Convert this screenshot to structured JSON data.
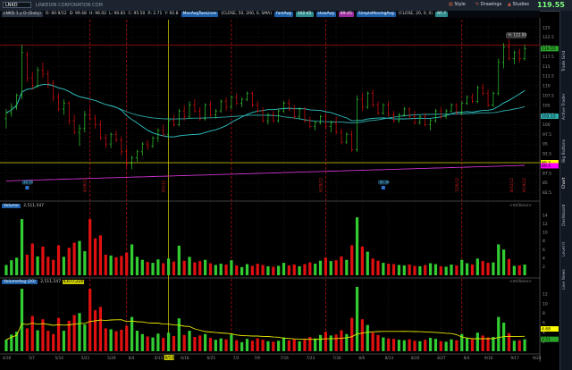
{
  "toolbar": {
    "symbol": "LNKD",
    "company_name": "LINKEDIN CORPORATION COM",
    "last_price": "119.55",
    "buttons": [
      "Style",
      "Drawings",
      "Studies"
    ]
  },
  "infobar": {
    "items": [
      {
        "text": "LNKD 1 y D (Daily)",
        "color": "#d6d6d6",
        "bg": "#2a3340"
      },
      {
        "text": "O: 60.9/12",
        "color": "#d6d6d6",
        "bg": ""
      },
      {
        "text": "D: 99.48",
        "color": "#d6d6d6",
        "bg": ""
      },
      {
        "text": "H: 96.02",
        "color": "#d6d6d6",
        "bg": ""
      },
      {
        "text": "L: 90.81",
        "color": "#d6d6d6",
        "bg": ""
      },
      {
        "text": "C: 95.50",
        "color": "#d6d6d6",
        "bg": ""
      },
      {
        "text": "R: 2.71",
        "color": "#d6d6d6",
        "bg": ""
      },
      {
        "text": "Y: 92.8",
        "color": "#d6d6d6",
        "bg": ""
      },
      {
        "text": "MovAvgTwoLines",
        "color": "#ffffff",
        "bg": "#1d5fa8"
      },
      {
        "text": "(CLOSE, 50, 200, 0, SMA)",
        "color": "#d6d6d6",
        "bg": ""
      },
      {
        "text": "fastAvg",
        "color": "#ffffff",
        "bg": "#1d5fa8"
      },
      {
        "text": "102.45",
        "color": "#ffffff",
        "bg": "#2f8c8c"
      },
      {
        "text": "slowAvg",
        "color": "#ffffff",
        "bg": "#1d5fa8"
      },
      {
        "text": "89.45",
        "color": "#ffffff",
        "bg": "#9c2d9c"
      },
      {
        "text": "SimpleMovingAvg",
        "color": "#ffffff",
        "bg": "#1d5fa8"
      },
      {
        "text": "(CLOSE, 20, 0, 0)",
        "color": "#d6d6d6",
        "bg": ""
      },
      {
        "text": "97.7",
        "color": "#ffffff",
        "bg": "#2f8c8c"
      }
    ],
    "copyright": "2012 ® TD Ameritrade IP Company, Inc."
  },
  "price_panel": {
    "y_ticks": [
      125,
      122.5,
      120,
      117.5,
      115,
      112.5,
      110,
      107.5,
      105,
      102.5,
      100,
      97.5,
      95,
      92.5,
      90,
      87.5,
      85,
      82.5
    ],
    "price_boxes": [
      {
        "text": "119.55",
        "bg": "#2aa52a",
        "y": 119.55
      },
      {
        "text": "102.15",
        "bg": "#2faaaa",
        "y": 102.15
      },
      {
        "text": "90.2",
        "bg": "#ffff00",
        "y": 90.2
      },
      {
        "text": "89.4",
        "bg": "#ff00ff",
        "y": 89.4
      }
    ],
    "high_label": "H: 122.00",
    "event_labels": [
      "4/26/12",
      "6/1/12",
      "6/29/12",
      "7/26/12",
      "8/31/12",
      "9/19/12"
    ],
    "dividend_markers": [
      "$0.15",
      "$0.16"
    ]
  },
  "volume_panel": {
    "title": "Volume",
    "value": "2,511,547",
    "units": "<millions>",
    "y_ticks": [
      14,
      12,
      10,
      8,
      6,
      4,
      2
    ]
  },
  "volavg_panel": {
    "title": "VolumeAvg (20)",
    "value1": "2,511,547",
    "value2": "4,677,220",
    "units": "<millions>",
    "y_ticks": [
      12,
      10,
      8,
      6,
      4,
      2
    ],
    "price_boxes": [
      {
        "text": "4.68",
        "bg": "#ffff00",
        "y": 4.68
      },
      {
        "text": "2.51",
        "bg": "#2aa52a",
        "y": 2.51
      }
    ]
  },
  "x_axis": {
    "labels": [
      "4/30",
      "5/7",
      "5/14",
      "5/21",
      "5/29",
      "6/4",
      "6/11",
      "6/18",
      "6/25",
      "7/2",
      "7/9",
      "7/16",
      "7/23",
      "7/30",
      "8/6",
      "8/13",
      "8/20",
      "8/27",
      "9/4",
      "9/10",
      "9/17",
      "9/24"
    ],
    "highlight": "6/13"
  },
  "right_tabs": [
    "Trade Grid",
    "Active Trader",
    "Big Buttons",
    "Chart",
    "Dashboard",
    "Level II",
    "Live News"
  ],
  "colors": {
    "up": "#32cd32",
    "down": "#e01010",
    "sma20": "#2ec5c5",
    "sma50": "#2faaaa",
    "sma200": "#cc33cc",
    "hline": "#b01010",
    "yline": "#d4d400",
    "vline": "#b01010"
  },
  "chart_data": {
    "type": "candlestick",
    "bars": [
      {
        "x": "4/30",
        "o": 101.5,
        "h": 104.0,
        "l": 99.0,
        "c": 103.0,
        "v": 2.4
      },
      {
        "x": "5/1",
        "o": 103.0,
        "h": 105.5,
        "l": 102.0,
        "c": 104.5,
        "v": 3.5
      },
      {
        "x": "5/2",
        "o": 104.5,
        "h": 108.0,
        "l": 103.8,
        "c": 107.5,
        "v": 4.1
      },
      {
        "x": "5/3",
        "o": 107.5,
        "h": 120.5,
        "l": 106.5,
        "c": 118.5,
        "v": 13.1
      },
      {
        "x": "5/4",
        "o": 118.0,
        "h": 118.8,
        "l": 111.0,
        "c": 112.0,
        "v": 4.8
      },
      {
        "x": "5/7",
        "o": 112.0,
        "h": 113.5,
        "l": 109.0,
        "c": 110.0,
        "v": 7.4
      },
      {
        "x": "5/8",
        "o": 110.0,
        "h": 114.8,
        "l": 109.5,
        "c": 114.0,
        "v": 4.4
      },
      {
        "x": "5/9",
        "o": 114.0,
        "h": 116.0,
        "l": 112.0,
        "c": 113.0,
        "v": 6.7
      },
      {
        "x": "5/10",
        "o": 113.0,
        "h": 114.0,
        "l": 109.5,
        "c": 110.5,
        "v": 4.3
      },
      {
        "x": "5/11",
        "o": 110.5,
        "h": 111.5,
        "l": 106.0,
        "c": 107.0,
        "v": 3.6
      },
      {
        "x": "5/14",
        "o": 107.0,
        "h": 108.0,
        "l": 103.5,
        "c": 104.0,
        "v": 7.0
      },
      {
        "x": "5/15",
        "o": 104.0,
        "h": 106.5,
        "l": 102.5,
        "c": 105.5,
        "v": 4.3
      },
      {
        "x": "5/16",
        "o": 105.5,
        "h": 106.0,
        "l": 100.0,
        "c": 101.0,
        "v": 6.4
      },
      {
        "x": "5/17",
        "o": 101.0,
        "h": 102.5,
        "l": 97.5,
        "c": 98.0,
        "v": 7.6
      },
      {
        "x": "5/18",
        "o": 98.0,
        "h": 100.0,
        "l": 94.5,
        "c": 99.0,
        "v": 8.0
      },
      {
        "x": "5/21",
        "o": 99.0,
        "h": 103.5,
        "l": 98.0,
        "c": 102.5,
        "v": 5.6
      },
      {
        "x": "5/22",
        "o": 102.5,
        "h": 104.5,
        "l": 101.0,
        "c": 101.5,
        "v": 13.1
      },
      {
        "x": "5/23",
        "o": 101.5,
        "h": 102.5,
        "l": 99.0,
        "c": 100.0,
        "v": 8.6
      },
      {
        "x": "5/24",
        "o": 100.0,
        "h": 101.0,
        "l": 96.0,
        "c": 96.5,
        "v": 9.3
      },
      {
        "x": "5/25",
        "o": 96.5,
        "h": 97.5,
        "l": 94.0,
        "c": 95.0,
        "v": 4.8
      },
      {
        "x": "5/29",
        "o": 95.0,
        "h": 98.0,
        "l": 94.0,
        "c": 97.5,
        "v": 4.6
      },
      {
        "x": "5/30",
        "o": 97.5,
        "h": 98.5,
        "l": 95.5,
        "c": 96.0,
        "v": 4.2
      },
      {
        "x": "5/31",
        "o": 96.0,
        "h": 97.0,
        "l": 92.0,
        "c": 93.0,
        "v": 4.5
      },
      {
        "x": "6/1",
        "o": 93.0,
        "h": 94.0,
        "l": 89.0,
        "c": 90.0,
        "v": 5.3
      },
      {
        "x": "6/4",
        "o": 90.0,
        "h": 92.0,
        "l": 88.5,
        "c": 91.5,
        "v": 7.2
      },
      {
        "x": "6/5",
        "o": 91.5,
        "h": 93.5,
        "l": 90.5,
        "c": 93.0,
        "v": 4.3
      },
      {
        "x": "6/6",
        "o": 93.0,
        "h": 95.5,
        "l": 92.0,
        "c": 95.0,
        "v": 3.6
      },
      {
        "x": "6/7",
        "o": 95.0,
        "h": 96.0,
        "l": 93.5,
        "c": 94.5,
        "v": 3.1
      },
      {
        "x": "6/8",
        "o": 94.5,
        "h": 97.0,
        "l": 94.0,
        "c": 96.5,
        "v": 2.9
      },
      {
        "x": "6/11",
        "o": 96.5,
        "h": 99.0,
        "l": 95.5,
        "c": 98.5,
        "v": 3.7
      },
      {
        "x": "6/12",
        "o": 98.5,
        "h": 100.0,
        "l": 97.0,
        "c": 97.5,
        "v": 2.8
      },
      {
        "x": "6/13",
        "o": 97.5,
        "h": 101.5,
        "l": 97.0,
        "c": 101.0,
        "v": 3.9
      },
      {
        "x": "6/14",
        "o": 101.0,
        "h": 102.5,
        "l": 99.5,
        "c": 100.0,
        "v": 3.2
      },
      {
        "x": "6/15",
        "o": 100.0,
        "h": 104.0,
        "l": 99.5,
        "c": 103.5,
        "v": 6.9
      },
      {
        "x": "6/18",
        "o": 103.5,
        "h": 105.0,
        "l": 101.0,
        "c": 102.0,
        "v": 3.4
      },
      {
        "x": "6/19",
        "o": 102.0,
        "h": 106.0,
        "l": 101.5,
        "c": 105.0,
        "v": 4.3
      },
      {
        "x": "6/20",
        "o": 105.0,
        "h": 106.5,
        "l": 103.0,
        "c": 103.5,
        "v": 3.0
      },
      {
        "x": "6/21",
        "o": 103.5,
        "h": 104.5,
        "l": 101.0,
        "c": 101.5,
        "v": 3.3
      },
      {
        "x": "6/22",
        "o": 101.5,
        "h": 105.5,
        "l": 101.0,
        "c": 105.0,
        "v": 3.6
      },
      {
        "x": "6/25",
        "o": 105.0,
        "h": 106.0,
        "l": 102.0,
        "c": 102.5,
        "v": 2.8
      },
      {
        "x": "6/26",
        "o": 102.5,
        "h": 104.0,
        "l": 101.5,
        "c": 103.5,
        "v": 2.4
      },
      {
        "x": "6/27",
        "o": 103.5,
        "h": 106.5,
        "l": 103.0,
        "c": 106.0,
        "v": 2.7
      },
      {
        "x": "6/28",
        "o": 106.0,
        "h": 107.0,
        "l": 103.5,
        "c": 104.5,
        "v": 2.5
      },
      {
        "x": "6/29",
        "o": 104.5,
        "h": 107.5,
        "l": 104.0,
        "c": 107.0,
        "v": 3.5
      },
      {
        "x": "7/2",
        "o": 107.0,
        "h": 108.0,
        "l": 105.0,
        "c": 105.5,
        "v": 2.3
      },
      {
        "x": "7/3",
        "o": 105.5,
        "h": 107.0,
        "l": 104.5,
        "c": 106.5,
        "v": 1.9
      },
      {
        "x": "7/5",
        "o": 106.5,
        "h": 108.5,
        "l": 106.0,
        "c": 108.0,
        "v": 2.6
      },
      {
        "x": "7/6",
        "o": 108.0,
        "h": 108.5,
        "l": 104.5,
        "c": 105.0,
        "v": 2.2
      },
      {
        "x": "7/9",
        "o": 105.0,
        "h": 106.0,
        "l": 103.0,
        "c": 103.5,
        "v": 2.7
      },
      {
        "x": "7/10",
        "o": 103.5,
        "h": 104.5,
        "l": 100.5,
        "c": 101.0,
        "v": 2.4
      },
      {
        "x": "7/11",
        "o": 101.0,
        "h": 103.0,
        "l": 100.0,
        "c": 102.5,
        "v": 2.1
      },
      {
        "x": "7/12",
        "o": 102.5,
        "h": 103.5,
        "l": 100.5,
        "c": 101.0,
        "v": 2.0
      },
      {
        "x": "7/13",
        "o": 101.0,
        "h": 104.0,
        "l": 100.5,
        "c": 103.5,
        "v": 2.2
      },
      {
        "x": "7/16",
        "o": 103.5,
        "h": 106.0,
        "l": 103.0,
        "c": 105.5,
        "v": 2.9
      },
      {
        "x": "7/17",
        "o": 105.5,
        "h": 106.5,
        "l": 103.5,
        "c": 104.0,
        "v": 2.3
      },
      {
        "x": "7/18",
        "o": 104.0,
        "h": 105.0,
        "l": 101.5,
        "c": 102.0,
        "v": 2.5
      },
      {
        "x": "7/19",
        "o": 102.0,
        "h": 104.5,
        "l": 101.5,
        "c": 104.0,
        "v": 2.1
      },
      {
        "x": "7/20",
        "o": 104.0,
        "h": 104.5,
        "l": 100.5,
        "c": 101.0,
        "v": 2.6
      },
      {
        "x": "7/23",
        "o": 101.0,
        "h": 102.0,
        "l": 99.0,
        "c": 99.5,
        "v": 3.0
      },
      {
        "x": "7/24",
        "o": 99.5,
        "h": 101.0,
        "l": 98.5,
        "c": 100.5,
        "v": 2.7
      },
      {
        "x": "7/25",
        "o": 100.5,
        "h": 102.5,
        "l": 100.0,
        "c": 102.0,
        "v": 3.4
      },
      {
        "x": "7/26",
        "o": 102.0,
        "h": 103.0,
        "l": 99.0,
        "c": 99.5,
        "v": 4.1
      },
      {
        "x": "7/27",
        "o": 99.5,
        "h": 101.0,
        "l": 98.0,
        "c": 100.5,
        "v": 3.3
      },
      {
        "x": "7/30",
        "o": 100.5,
        "h": 102.0,
        "l": 97.5,
        "c": 98.0,
        "v": 3.5
      },
      {
        "x": "7/31",
        "o": 98.0,
        "h": 99.0,
        "l": 95.0,
        "c": 95.5,
        "v": 4.4
      },
      {
        "x": "8/1",
        "o": 95.5,
        "h": 98.0,
        "l": 95.0,
        "c": 97.5,
        "v": 3.6
      },
      {
        "x": "8/2",
        "o": 97.5,
        "h": 98.5,
        "l": 93.0,
        "c": 93.5,
        "v": 7.0
      },
      {
        "x": "8/3",
        "o": 93.5,
        "h": 107.5,
        "l": 93.0,
        "c": 106.5,
        "v": 13.5
      },
      {
        "x": "8/6",
        "o": 106.5,
        "h": 108.0,
        "l": 103.5,
        "c": 104.5,
        "v": 6.7
      },
      {
        "x": "8/7",
        "o": 104.5,
        "h": 108.5,
        "l": 104.0,
        "c": 108.0,
        "v": 5.5
      },
      {
        "x": "8/8",
        "o": 108.0,
        "h": 109.0,
        "l": 104.5,
        "c": 105.0,
        "v": 3.9
      },
      {
        "x": "8/9",
        "o": 105.0,
        "h": 106.0,
        "l": 102.5,
        "c": 103.0,
        "v": 3.4
      },
      {
        "x": "8/10",
        "o": 103.0,
        "h": 105.5,
        "l": 102.5,
        "c": 105.0,
        "v": 2.9
      },
      {
        "x": "8/13",
        "o": 105.0,
        "h": 106.0,
        "l": 102.0,
        "c": 102.5,
        "v": 2.7
      },
      {
        "x": "8/14",
        "o": 102.5,
        "h": 103.5,
        "l": 100.5,
        "c": 101.0,
        "v": 2.6
      },
      {
        "x": "8/15",
        "o": 101.0,
        "h": 103.0,
        "l": 100.5,
        "c": 102.5,
        "v": 2.4
      },
      {
        "x": "8/16",
        "o": 102.5,
        "h": 104.5,
        "l": 102.0,
        "c": 104.0,
        "v": 2.3
      },
      {
        "x": "8/17",
        "o": 104.0,
        "h": 104.5,
        "l": 101.5,
        "c": 102.0,
        "v": 2.5
      },
      {
        "x": "8/20",
        "o": 102.0,
        "h": 103.5,
        "l": 100.0,
        "c": 100.5,
        "v": 2.2
      },
      {
        "x": "8/21",
        "o": 100.5,
        "h": 102.5,
        "l": 100.0,
        "c": 102.0,
        "v": 2.1
      },
      {
        "x": "8/22",
        "o": 102.0,
        "h": 103.0,
        "l": 99.5,
        "c": 100.0,
        "v": 2.4
      },
      {
        "x": "8/23",
        "o": 100.0,
        "h": 101.5,
        "l": 98.5,
        "c": 101.0,
        "v": 2.8
      },
      {
        "x": "8/24",
        "o": 101.0,
        "h": 104.0,
        "l": 100.5,
        "c": 103.5,
        "v": 2.6
      },
      {
        "x": "8/27",
        "o": 103.5,
        "h": 104.5,
        "l": 101.5,
        "c": 102.0,
        "v": 2.1
      },
      {
        "x": "8/28",
        "o": 102.0,
        "h": 104.0,
        "l": 101.5,
        "c": 103.5,
        "v": 2.0
      },
      {
        "x": "8/29",
        "o": 103.5,
        "h": 105.5,
        "l": 103.0,
        "c": 105.0,
        "v": 2.5
      },
      {
        "x": "8/30",
        "o": 105.0,
        "h": 105.5,
        "l": 102.5,
        "c": 103.0,
        "v": 2.3
      },
      {
        "x": "8/31",
        "o": 103.0,
        "h": 106.0,
        "l": 102.5,
        "c": 105.5,
        "v": 3.6
      },
      {
        "x": "9/4",
        "o": 105.5,
        "h": 107.5,
        "l": 105.0,
        "c": 107.0,
        "v": 2.8
      },
      {
        "x": "9/5",
        "o": 107.0,
        "h": 108.0,
        "l": 105.5,
        "c": 106.0,
        "v": 2.5
      },
      {
        "x": "9/6",
        "o": 106.0,
        "h": 110.0,
        "l": 105.5,
        "c": 109.5,
        "v": 3.9
      },
      {
        "x": "9/7",
        "o": 109.5,
        "h": 110.5,
        "l": 107.5,
        "c": 108.0,
        "v": 3.3
      },
      {
        "x": "9/10",
        "o": 108.0,
        "h": 109.0,
        "l": 104.5,
        "c": 105.0,
        "v": 2.9
      },
      {
        "x": "9/11",
        "o": 105.0,
        "h": 108.5,
        "l": 104.5,
        "c": 108.0,
        "v": 3.0
      },
      {
        "x": "9/12",
        "o": 108.0,
        "h": 117.0,
        "l": 107.5,
        "c": 116.0,
        "v": 7.2
      },
      {
        "x": "9/13",
        "o": 116.0,
        "h": 121.0,
        "l": 114.5,
        "c": 120.0,
        "v": 6.0
      },
      {
        "x": "9/14",
        "o": 120.0,
        "h": 122.0,
        "l": 116.5,
        "c": 117.0,
        "v": 3.8
      },
      {
        "x": "9/17",
        "o": 117.0,
        "h": 119.0,
        "l": 115.5,
        "c": 118.5,
        "v": 2.2
      },
      {
        "x": "9/18",
        "o": 118.5,
        "h": 119.5,
        "l": 116.0,
        "c": 117.0,
        "v": 2.3
      },
      {
        "x": "9/19",
        "o": 117.0,
        "h": 120.5,
        "l": 116.5,
        "c": 119.55,
        "v": 2.51
      }
    ]
  }
}
